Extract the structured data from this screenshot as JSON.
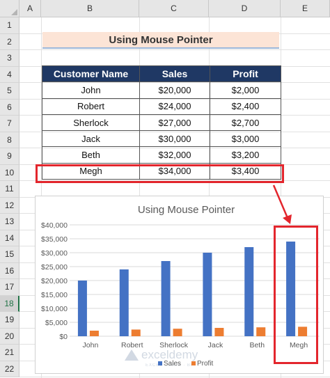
{
  "sheet": {
    "columns": [
      "A",
      "B",
      "C",
      "D",
      "E"
    ],
    "rows": [
      "1",
      "2",
      "3",
      "4",
      "5",
      "6",
      "7",
      "8",
      "9",
      "10",
      "11",
      "12",
      "13",
      "14",
      "15",
      "16",
      "17",
      "18",
      "19",
      "20",
      "21",
      "22"
    ],
    "selected_row": "18"
  },
  "title": "Using Mouse Pointer",
  "table": {
    "headers": [
      "Customer Name",
      "Sales",
      "Profit"
    ],
    "rows": [
      [
        "John",
        "$20,000",
        "$2,000"
      ],
      [
        "Robert",
        "$24,000",
        "$2,400"
      ],
      [
        "Sherlock",
        "$27,000",
        "$2,700"
      ],
      [
        "Jack",
        "$30,000",
        "$3,000"
      ],
      [
        "Beth",
        "$32,000",
        "$3,200"
      ],
      [
        "Megh",
        "$34,000",
        "$3,400"
      ]
    ]
  },
  "watermark": {
    "name": "exceldemy",
    "tagline": "EXCEL · DATA · BI"
  },
  "chart_data": {
    "type": "bar",
    "title": "Using Mouse Pointer",
    "categories": [
      "John",
      "Robert",
      "Sherlock",
      "Jack",
      "Beth",
      "Megh"
    ],
    "series": [
      {
        "name": "Sales",
        "values": [
          20000,
          24000,
          27000,
          30000,
          32000,
          34000
        ],
        "color": "#4472c4"
      },
      {
        "name": "Profit",
        "values": [
          2000,
          2400,
          2700,
          3000,
          3200,
          3400
        ],
        "color": "#ed7d31"
      }
    ],
    "ylim": [
      0,
      40000
    ],
    "ytick_labels": [
      "$0",
      "$5,000",
      "$10,000",
      "$15,000",
      "$20,000",
      "$25,000",
      "$30,000",
      "$35,000",
      "$40,000"
    ],
    "grid": true,
    "legend": "bottom"
  },
  "colors": {
    "highlight": "#e3262d",
    "header_fill": "#1f3864",
    "title_fill": "#fce4d6"
  }
}
